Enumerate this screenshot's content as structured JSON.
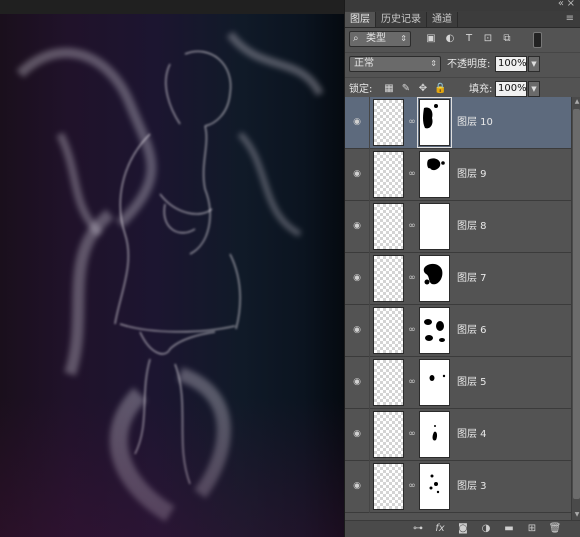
{
  "panel": {
    "tabs": [
      "图层",
      "历史记录",
      "通道"
    ],
    "filter": {
      "kind_label": "类型"
    },
    "blend_mode": "正常",
    "opacity": {
      "label": "不透明度:",
      "value": "100%"
    },
    "lock_label": "锁定:",
    "fill": {
      "label": "填充:",
      "value": "100%"
    }
  },
  "layers": [
    {
      "name": "图层 10",
      "active": true
    },
    {
      "name": "图层 9",
      "active": false
    },
    {
      "name": "图层 8",
      "active": false
    },
    {
      "name": "图层 7",
      "active": false
    },
    {
      "name": "图层 6",
      "active": false
    },
    {
      "name": "图层 5",
      "active": false
    },
    {
      "name": "图层 4",
      "active": false
    },
    {
      "name": "图层 3",
      "active": false
    }
  ],
  "icons": {
    "eye": "eye-icon",
    "chain": "link-icon",
    "footer": [
      "link-layers-icon",
      "fx-icon",
      "add-mask-icon",
      "adjustment-icon",
      "group-folder-icon",
      "new-layer-icon",
      "trash-icon"
    ]
  },
  "colors": {
    "panel": "#535353",
    "active_row": "#5d6a7d",
    "canvas_left": "#1a0f1c",
    "canvas_right": "#050a10"
  }
}
